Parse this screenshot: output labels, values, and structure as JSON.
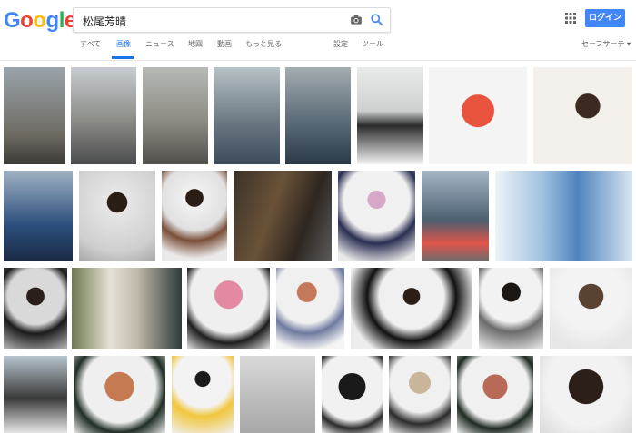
{
  "header": {
    "logo_text": "Google",
    "search_query": "松尾芳晴",
    "login_label": "ログイン",
    "icons": [
      "camera-icon",
      "search-icon",
      "apps-icon"
    ]
  },
  "nav": {
    "tabs": [
      {
        "label": "すべて"
      },
      {
        "label": "画像",
        "active": true
      },
      {
        "label": "ニュース"
      },
      {
        "label": "地図"
      },
      {
        "label": "動画"
      },
      {
        "label": "もっと見る"
      },
      {
        "label": "設定"
      },
      {
        "label": "ツール"
      }
    ],
    "safesearch_label": "セーフサーチ ▾"
  },
  "colors": {
    "accent": "#1a73e8",
    "login_bg": "#4285f4",
    "logo_blue": "#4285f4",
    "logo_red": "#ea4335",
    "logo_yellow": "#fbbc05",
    "logo_green": "#34a853"
  },
  "results": {
    "rows": 4,
    "thumbnails": [
      {
        "desc": "street-style-man"
      },
      {
        "desc": "street-style-man"
      },
      {
        "desc": "street-style-man"
      },
      {
        "desc": "street-style-man"
      },
      {
        "desc": "street-style-man"
      },
      {
        "desc": "street-style-man"
      },
      {
        "desc": "man-red-cap"
      },
      {
        "desc": "man-white-shirt"
      },
      {
        "desc": "man-denim"
      },
      {
        "desc": "man-gray-sweater"
      },
      {
        "desc": "man-brown-jacket"
      },
      {
        "desc": "two-men-bar"
      },
      {
        "desc": "man-navy-sweater"
      },
      {
        "desc": "man-street"
      },
      {
        "desc": "man-blue-shirt-bokeh"
      },
      {
        "desc": "man-portrait"
      },
      {
        "desc": "alley-scene"
      },
      {
        "desc": "woman-pink-hair"
      },
      {
        "desc": "woman-chair"
      },
      {
        "desc": "woman-black-top"
      },
      {
        "desc": "man-cardigan"
      },
      {
        "desc": "woman-long-hair"
      },
      {
        "desc": "woman-outdoor"
      },
      {
        "desc": "woman-red-hair"
      },
      {
        "desc": "woman-yellow-shirt"
      },
      {
        "desc": "performer-arms-up"
      },
      {
        "desc": "woman-dark-hair"
      },
      {
        "desc": "woman-bob"
      },
      {
        "desc": "woman-short-red"
      },
      {
        "desc": "woman-long-dark"
      }
    ]
  }
}
